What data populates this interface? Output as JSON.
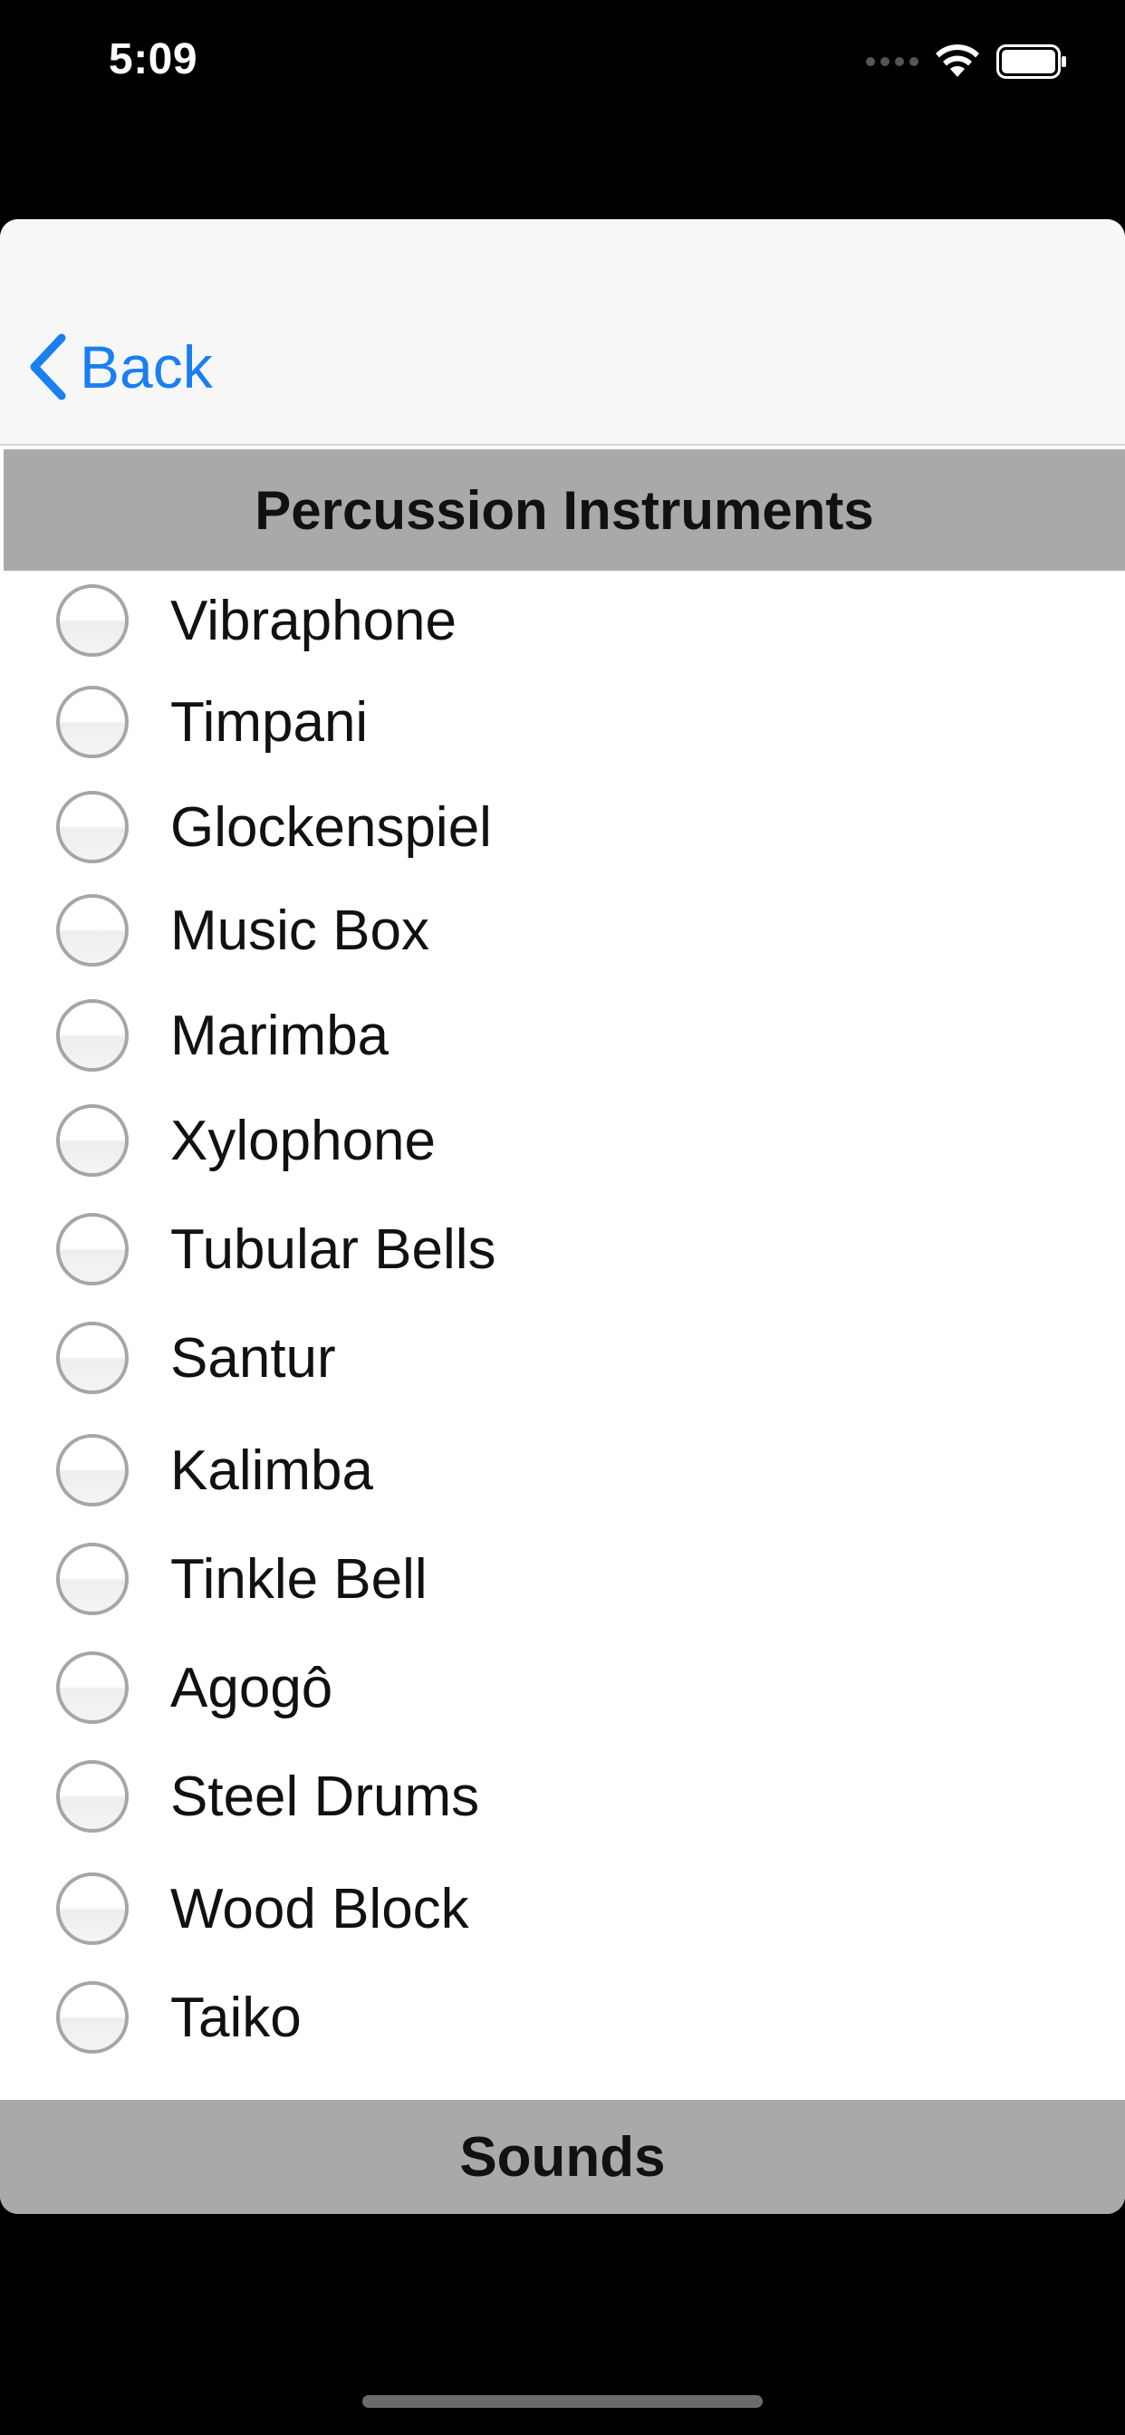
{
  "status_bar": {
    "time": "5:09",
    "icons": [
      "cellular-signal-icon",
      "wifi-icon",
      "battery-icon"
    ]
  },
  "nav": {
    "back_label": "Back",
    "back_icon": "chevron-left-icon",
    "accent_color": "#1a7ff0"
  },
  "section": {
    "title": "Percussion Instruments"
  },
  "instruments": [
    {
      "label": "Vibraphone",
      "selected": false
    },
    {
      "label": "Timpani",
      "selected": false
    },
    {
      "label": "Glockenspiel",
      "selected": false
    },
    {
      "label": "Music Box",
      "selected": false
    },
    {
      "label": "Marimba",
      "selected": false
    },
    {
      "label": "Xylophone",
      "selected": false
    },
    {
      "label": "Tubular Bells",
      "selected": false
    },
    {
      "label": "Santur",
      "selected": false
    },
    {
      "label": "Kalimba",
      "selected": false
    },
    {
      "label": "Tinkle Bell",
      "selected": false
    },
    {
      "label": "Agogô",
      "selected": false
    },
    {
      "label": "Steel Drums",
      "selected": false
    },
    {
      "label": "Wood Block",
      "selected": false
    },
    {
      "label": "Taiko",
      "selected": false
    }
  ],
  "footer": {
    "label": "Sounds"
  }
}
